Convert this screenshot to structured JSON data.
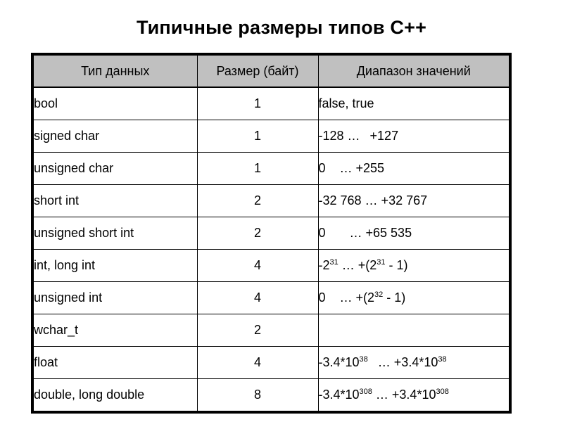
{
  "slide": {
    "title": "Типичные размеры типов C++",
    "background_color": "#ffffff",
    "text_color": "#000000"
  },
  "table": {
    "header_background": "#c0c0c0",
    "border_color": "#000000",
    "columns": [
      {
        "key": "type",
        "label": "Тип данных",
        "align": "left"
      },
      {
        "key": "size",
        "label": "Размер (байт)",
        "align": "center"
      },
      {
        "key": "range",
        "label": "Диапазон значений",
        "align": "left"
      }
    ],
    "rows": [
      {
        "type": "bool",
        "size": "1",
        "range_html": "false, true",
        "range_text": "false, true"
      },
      {
        "type": "signed char",
        "size": "1",
        "range_html": "-128 …<span class=\"gap-s\"></span> +127",
        "range_text": "-128 … +127"
      },
      {
        "type": "unsigned char",
        "size": "1",
        "range_html": "0<span class=\"gap-m\"></span>… +255",
        "range_text": "0 … +255"
      },
      {
        "type": "short int",
        "size": "2",
        "range_html": "-32 768 … +32 767",
        "range_text": "-32 768 … +32 767"
      },
      {
        "type": "unsigned short int",
        "size": "2",
        "range_html": "0<span class=\"gap-l\"></span>… +65 535",
        "range_text": "0 … +65 535"
      },
      {
        "type": "int, long int",
        "size": "4",
        "range_html": "-2<sup>31</sup> … +(2<sup>31</sup> - 1)",
        "range_text": "-2^31 … +(2^31 - 1)"
      },
      {
        "type": "unsigned int",
        "size": "4",
        "range_html": "0<span class=\"gap-m\"></span>… +(2<sup>32</sup> - 1)",
        "range_text": "0 … +(2^32 - 1)"
      },
      {
        "type": "wchar_t",
        "size": "2",
        "range_html": "",
        "range_text": ""
      },
      {
        "type": "float",
        "size": "4",
        "range_html": "-3.4*10<sup>38</sup><span class=\"gap-s\"></span> … +3.4*10<sup>38</sup>",
        "range_text": "-3.4*10^38 … +3.4*10^38"
      },
      {
        "type": "double, long double",
        "size": "8",
        "range_html": "-3.4*10<sup>308</sup> … +3.4*10<sup>308</sup>",
        "range_text": "-3.4*10^308 … +3.4*10^308"
      }
    ]
  }
}
